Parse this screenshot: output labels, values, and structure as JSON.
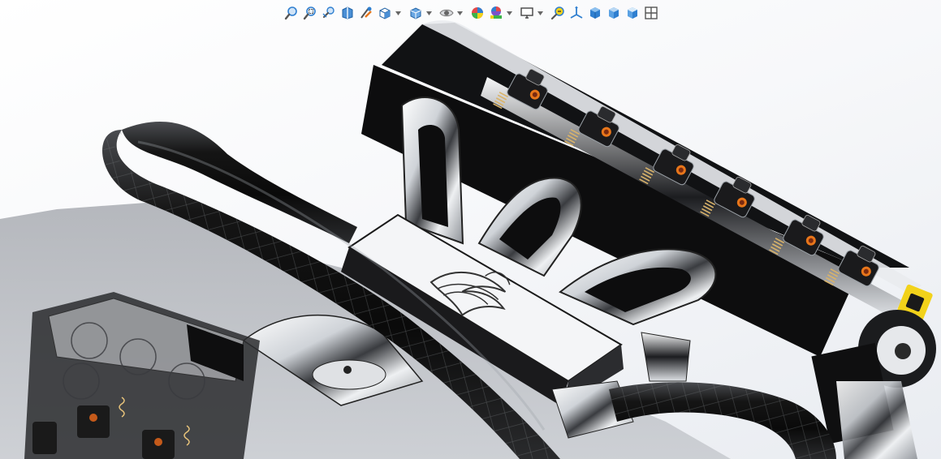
{
  "app": {
    "type": "cad-3d-viewport"
  },
  "hud_toolbar": {
    "items": [
      {
        "name": "zoom-to-fit-icon",
        "kind": "button"
      },
      {
        "name": "zoom-to-area-icon",
        "kind": "button"
      },
      {
        "name": "previous-view-icon",
        "kind": "button"
      },
      {
        "name": "section-view-icon",
        "kind": "button"
      },
      {
        "name": "dynamic-annotation-views-icon",
        "kind": "button"
      },
      {
        "name": "view-orientation-icon",
        "kind": "button",
        "dropdown": true
      },
      {
        "name": "display-style-icon",
        "kind": "button",
        "dropdown": true
      },
      {
        "name": "hide-show-items-icon",
        "kind": "button",
        "dropdown": true
      },
      {
        "name": "edit-appearance-icon",
        "kind": "button"
      },
      {
        "name": "apply-scene-icon",
        "kind": "button",
        "dropdown": true
      },
      {
        "name": "view-settings-icon",
        "kind": "button",
        "dropdown": true
      },
      {
        "name": "zoom-in-out-icon",
        "kind": "button"
      },
      {
        "name": "reference-triad-icon",
        "kind": "button"
      },
      {
        "name": "isometric-cube-icon",
        "kind": "button"
      },
      {
        "name": "front-cube-icon",
        "kind": "button"
      },
      {
        "name": "right-cube-icon",
        "kind": "button"
      },
      {
        "name": "four-view-icon",
        "kind": "button"
      }
    ]
  },
  "colors": {
    "background_top": "#ffffff",
    "background_bottom": "#e9ecf1",
    "toolbar_blue": "#2f7fd0",
    "hose_black": "#121212",
    "chrome_silver": "#d9dde2",
    "accent_yellow": "#f2d21a",
    "accent_orange": "#e8761a"
  },
  "model": {
    "name_visible": false
  }
}
